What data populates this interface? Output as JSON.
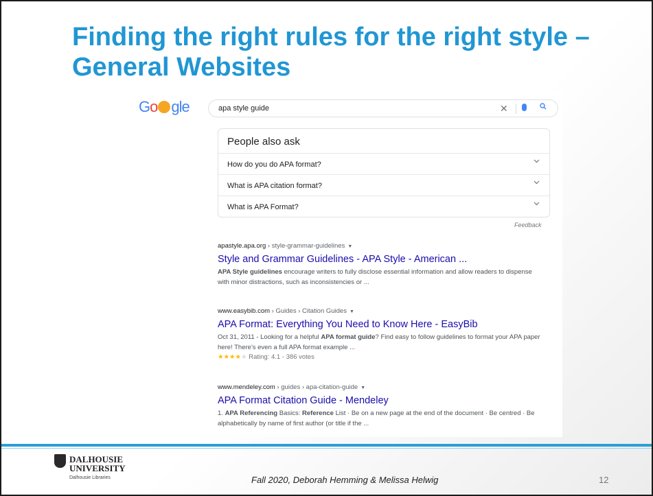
{
  "slide": {
    "title": "Finding the right rules for the right style – General Websites",
    "footer": "Fall 2020, Deborah Hemming & Melissa Helwig",
    "page_number": "12",
    "logo_line1": "DALHOUSIE",
    "logo_line2": "UNIVERSITY",
    "logo_line3": "Dalhousie Libraries"
  },
  "google": {
    "logo_text": [
      "G",
      "o",
      "gle"
    ],
    "query": "apa style guide",
    "clear_glyph": "✕",
    "people_also_ask": {
      "heading": "People also ask",
      "questions": [
        "How do you do APA format?",
        "What is APA citation format?",
        "What is APA Format?"
      ]
    },
    "feedback": "Feedback",
    "results": [
      {
        "domain": "apastyle.apa.org",
        "path": " › style-grammar-guidelines",
        "title": "Style and Grammar Guidelines - APA Style - American ...",
        "snippet_bold": "APA Style guidelines",
        "snippet": " encourage writers to fully disclose essential information and allow readers to dispense with minor distractions, such as inconsistencies or ..."
      },
      {
        "domain": "www.easybib.com",
        "path": " › Guides › Citation Guides",
        "title": "APA Format: Everything You Need to Know Here - EasyBib",
        "snippet_pre": "Oct 31, 2011 - Looking for a helpful ",
        "snippet_bold": "APA format guide",
        "snippet": "? Find easy to follow guidelines to format your APA paper here! There's even a full APA format example ...",
        "rating_stars_on": "★★★★",
        "rating_stars_off": "★",
        "rating": "Rating: 4.1 - 386 votes"
      },
      {
        "domain": "www.mendeley.com",
        "path": " › guides › apa-citation-guide",
        "title": "APA Format Citation Guide - Mendeley",
        "snippet_pre": "1. ",
        "snippet_bold": "APA Referencing",
        "snippet_mid": " Basics: ",
        "snippet_bold2": "Reference",
        "snippet": " List · Be on a new page at the end of the document · Be centred · Be alphabetically by name of first author (or title if the ..."
      }
    ]
  },
  "colors": {
    "title_blue": "#2196d3",
    "link_blue": "#1a0dab",
    "bar_blue": "#2a9fd6"
  },
  "icons": [
    "clear-icon",
    "mic-icon",
    "search-icon",
    "chevron-down-icon",
    "dropdown-caret-icon",
    "shield-icon"
  ]
}
